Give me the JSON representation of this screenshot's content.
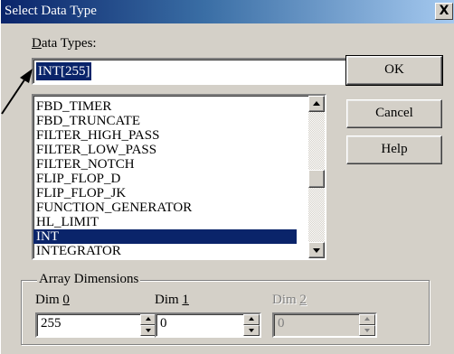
{
  "window": {
    "title": "Select Data Type",
    "close_glyph": "X"
  },
  "data_types": {
    "label_hotkey": "D",
    "label_rest": "ata Types:",
    "value": "INT[255]"
  },
  "list": {
    "items": [
      "FBD_TIMER",
      "FBD_TRUNCATE",
      "FILTER_HIGH_PASS",
      "FILTER_LOW_PASS",
      "FILTER_NOTCH",
      "FLIP_FLOP_D",
      "FLIP_FLOP_JK",
      "FUNCTION_GENERATOR",
      "HL_LIMIT",
      "INT",
      "INTEGRATOR"
    ],
    "selected": "INT"
  },
  "buttons": {
    "ok": "OK",
    "cancel": "Cancel",
    "help": "Help"
  },
  "array_dimensions": {
    "title": "Array Dimensions",
    "dims": [
      {
        "label": "Dim ",
        "hotkey": "0",
        "value": "255",
        "enabled": true
      },
      {
        "label": "Dim ",
        "hotkey": "1",
        "value": "0",
        "enabled": true
      },
      {
        "label": "Dim ",
        "hotkey": "2",
        "value": "0",
        "enabled": false
      }
    ]
  },
  "colors": {
    "title_bar": "#0a246a",
    "selection": "#0a246a",
    "face": "#d4d0c8"
  },
  "icons": {
    "annotation": "pointer-arrow-icon"
  }
}
